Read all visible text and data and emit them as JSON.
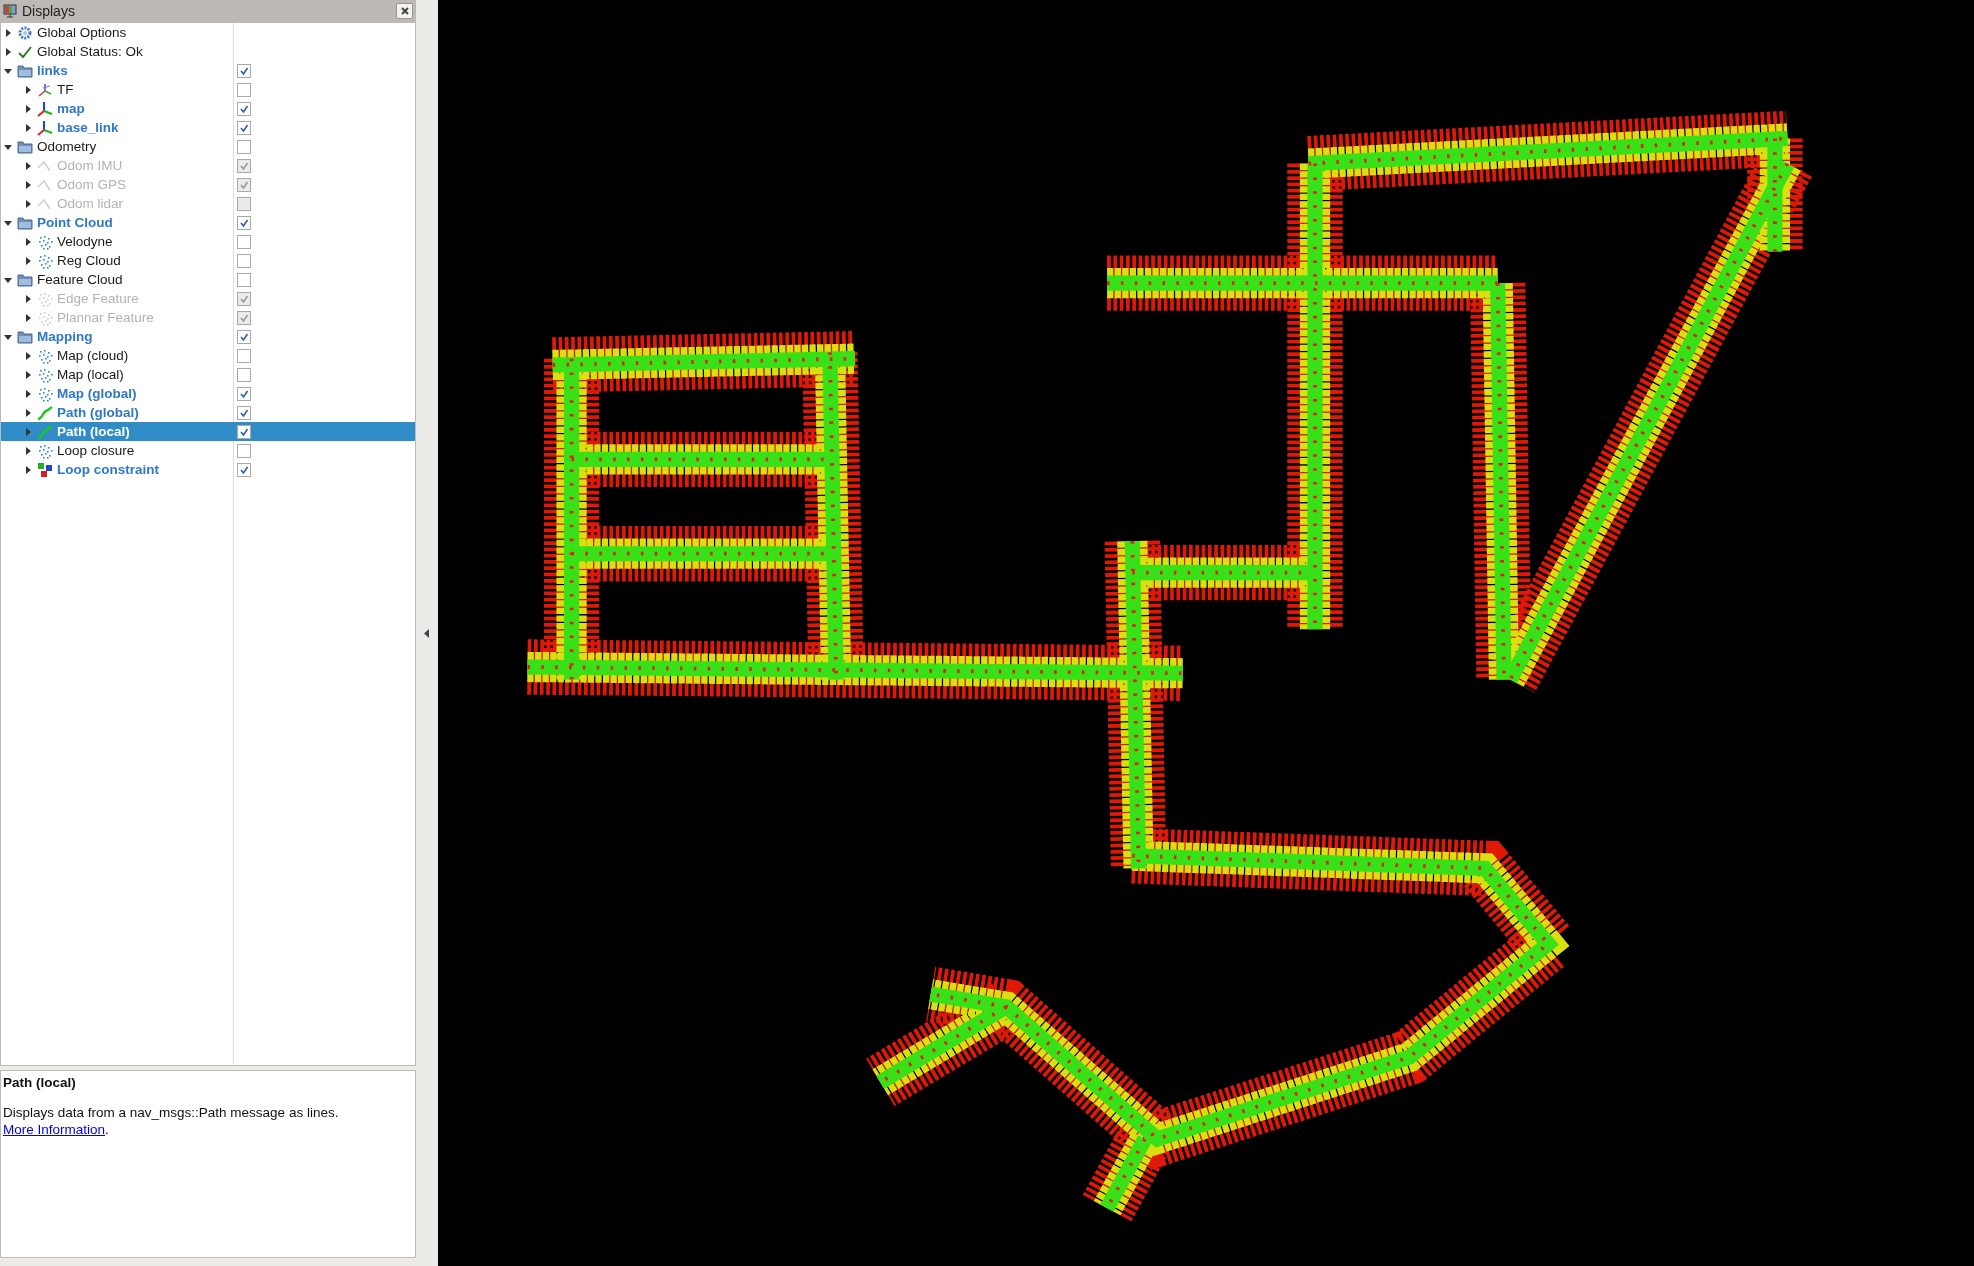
{
  "panel": {
    "title": "Displays"
  },
  "displays": [
    {
      "kind": "options",
      "label": "Global Options",
      "expanded": false,
      "selected": false
    },
    {
      "kind": "status",
      "label": "Global Status: Ok",
      "expanded": false,
      "selected": false
    },
    {
      "kind": "group",
      "label": "links",
      "expanded": true,
      "checked": true,
      "disabled": false,
      "selected": false,
      "children": [
        {
          "kind": "tf",
          "label": "TF",
          "expanded": false,
          "checked": false,
          "disabled": false,
          "selected": false
        },
        {
          "kind": "axes",
          "label": "map",
          "expanded": false,
          "checked": true,
          "disabled": false,
          "selected": false
        },
        {
          "kind": "axes",
          "label": "base_link",
          "expanded": false,
          "checked": true,
          "disabled": false,
          "selected": false
        }
      ]
    },
    {
      "kind": "group",
      "label": "Odometry",
      "expanded": true,
      "checked": false,
      "disabled": false,
      "selected": false,
      "children": [
        {
          "kind": "odometry",
          "label": "Odom IMU",
          "expanded": false,
          "checked": true,
          "disabled": true,
          "selected": false
        },
        {
          "kind": "odometry",
          "label": "Odom GPS",
          "expanded": false,
          "checked": true,
          "disabled": true,
          "selected": false
        },
        {
          "kind": "odometry",
          "label": "Odom lidar",
          "expanded": false,
          "checked": false,
          "disabled": true,
          "selected": false
        }
      ]
    },
    {
      "kind": "group",
      "label": "Point Cloud",
      "expanded": true,
      "checked": true,
      "disabled": false,
      "selected": false,
      "children": [
        {
          "kind": "cloud",
          "label": "Velodyne",
          "expanded": false,
          "checked": false,
          "disabled": false,
          "selected": false
        },
        {
          "kind": "cloud",
          "label": "Reg Cloud",
          "expanded": false,
          "checked": false,
          "disabled": false,
          "selected": false
        }
      ]
    },
    {
      "kind": "group",
      "label": "Feature Cloud",
      "expanded": true,
      "checked": false,
      "disabled": false,
      "selected": false,
      "children": [
        {
          "kind": "cloud",
          "label": "Edge Feature",
          "expanded": false,
          "checked": true,
          "disabled": true,
          "selected": false
        },
        {
          "kind": "cloud",
          "label": "Plannar Feature",
          "expanded": false,
          "checked": true,
          "disabled": true,
          "selected": false
        }
      ]
    },
    {
      "kind": "group",
      "label": "Mapping",
      "expanded": true,
      "checked": true,
      "disabled": false,
      "selected": false,
      "children": [
        {
          "kind": "cloud",
          "label": "Map (cloud)",
          "expanded": false,
          "checked": false,
          "disabled": false,
          "selected": false
        },
        {
          "kind": "cloud",
          "label": "Map (local)",
          "expanded": false,
          "checked": false,
          "disabled": false,
          "selected": false
        },
        {
          "kind": "cloud",
          "label": "Map (global)",
          "expanded": false,
          "checked": true,
          "disabled": false,
          "selected": false
        },
        {
          "kind": "path",
          "label": "Path (global)",
          "expanded": false,
          "checked": true,
          "disabled": false,
          "selected": false
        },
        {
          "kind": "path",
          "label": "Path (local)",
          "expanded": false,
          "checked": true,
          "disabled": false,
          "selected": true
        },
        {
          "kind": "cloud",
          "label": "Loop closure",
          "expanded": false,
          "checked": false,
          "disabled": false,
          "selected": false
        },
        {
          "kind": "marker",
          "label": "Loop constraint",
          "expanded": false,
          "checked": true,
          "disabled": false,
          "selected": false
        }
      ]
    }
  ],
  "description": {
    "title": "Path (local)",
    "text": "Displays data from a nav_msgs::Path message as lines.",
    "link": "More Information",
    "after": "."
  }
}
